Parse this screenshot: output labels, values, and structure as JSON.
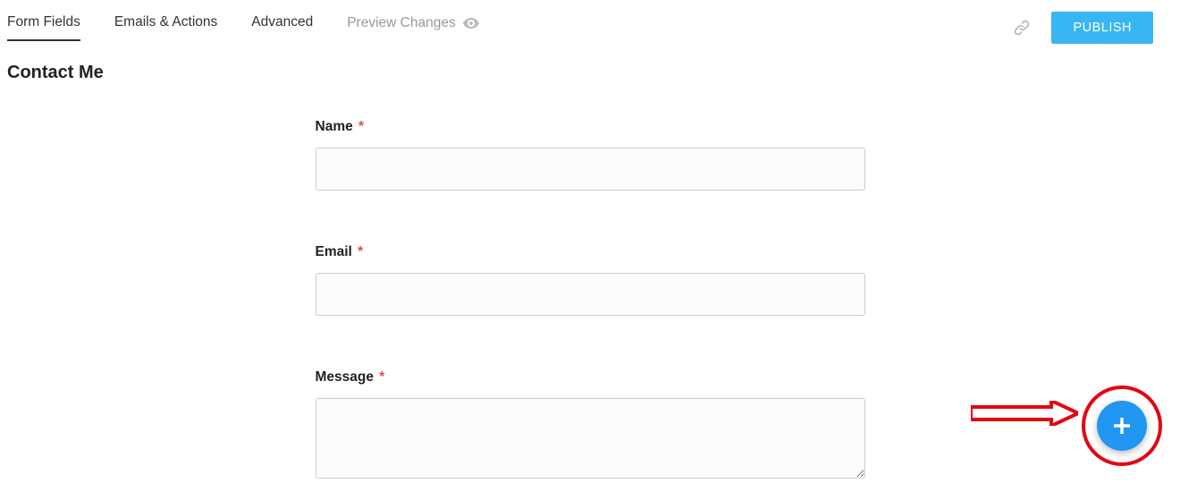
{
  "tabs": {
    "form_fields": "Form Fields",
    "emails_actions": "Emails & Actions",
    "advanced": "Advanced",
    "preview_changes": "Preview Changes"
  },
  "actions": {
    "publish": "PUBLISH"
  },
  "form": {
    "title": "Contact Me",
    "fields": {
      "name": {
        "label": "Name",
        "required": "*"
      },
      "email": {
        "label": "Email",
        "required": "*"
      },
      "message": {
        "label": "Message",
        "required": "*"
      }
    }
  }
}
